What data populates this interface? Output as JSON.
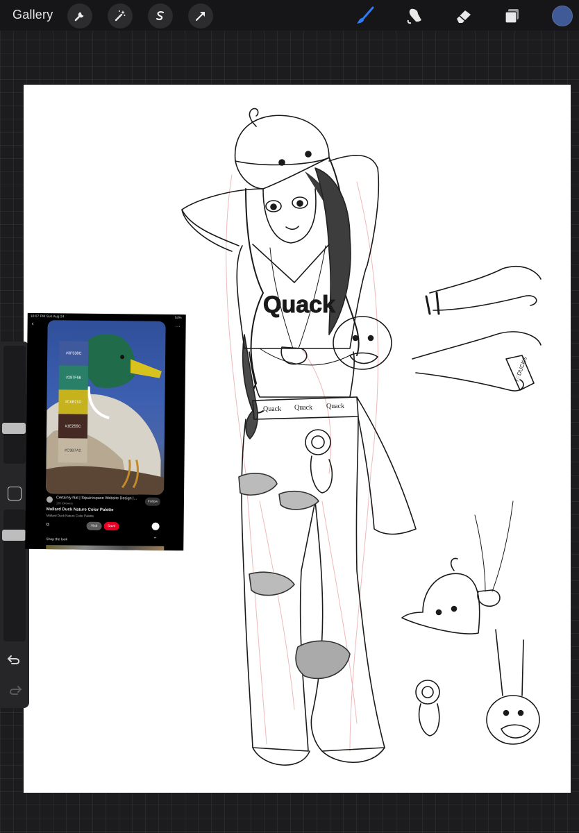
{
  "app": {
    "gallery_label": "Gallery",
    "accent_color": "#2f7bf6",
    "current_color": "#3f5a96"
  },
  "toolbar": {
    "left_tools": [
      {
        "name": "actions",
        "icon": "wrench-icon"
      },
      {
        "name": "adjustments",
        "icon": "magic-wand-icon"
      },
      {
        "name": "selection",
        "icon": "selection-s-icon"
      },
      {
        "name": "transform",
        "icon": "arrow-cursor-icon"
      }
    ],
    "right_tools": [
      {
        "name": "brush",
        "icon": "brush-icon",
        "active": true
      },
      {
        "name": "smudge",
        "icon": "smudge-icon"
      },
      {
        "name": "eraser",
        "icon": "eraser-icon"
      },
      {
        "name": "layers",
        "icon": "layers-icon"
      }
    ]
  },
  "sidebar": {
    "brush_size_level": 0.72,
    "opacity_level": 0.05
  },
  "artwork": {
    "shirt_text": "Quack",
    "waistband_text": [
      "Quack",
      "Quack",
      "Quack"
    ],
    "bracelet_text": "I♡DUCKS"
  },
  "reference": {
    "status_time": "10:07 PM   Sun Aug 24",
    "status_battery": "54%",
    "more_label": "···",
    "swatches": [
      {
        "hex": "#3F5A9C",
        "label": "#3F538C"
      },
      {
        "hex": "#297F68",
        "label": "#297F68"
      },
      {
        "hex": "#C6B21D",
        "label": "#C6B21D"
      },
      {
        "hex": "#452A24",
        "label": "#1E255C"
      },
      {
        "hex": "#C3B7A2",
        "label": "#C3B7A2"
      }
    ],
    "author": "Certainly Nat | Squarespace Website Design |...",
    "followers": "12K followers",
    "follow_label": "Follow",
    "pin_title": "Mallard Duck Nature Color Palette",
    "pin_subtitle": "Mallard Duck Nature Color Palette",
    "visit_label": "Visit",
    "save_label": "Save",
    "shop_label": "Shop the look"
  }
}
